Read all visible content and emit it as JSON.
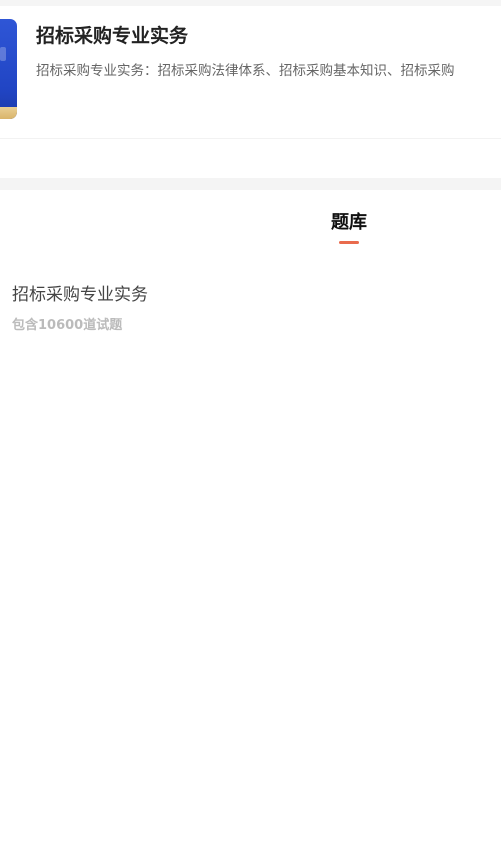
{
  "course": {
    "title": "招标采购专业实务",
    "description": "招标采购专业实务：招标采购法律体系、招标采购基本知识、招标采购",
    "cover_colors": {
      "primary": "#2145c4",
      "accent": "#d9b46a"
    }
  },
  "tabs": [
    {
      "label": "题库",
      "active": true
    }
  ],
  "colors": {
    "tab_indicator": "#e96b4d",
    "section_gap": "#f4f4f4"
  },
  "question_banks": [
    {
      "title": "招标采购专业实务",
      "count_text": "包含10600道试题"
    }
  ]
}
